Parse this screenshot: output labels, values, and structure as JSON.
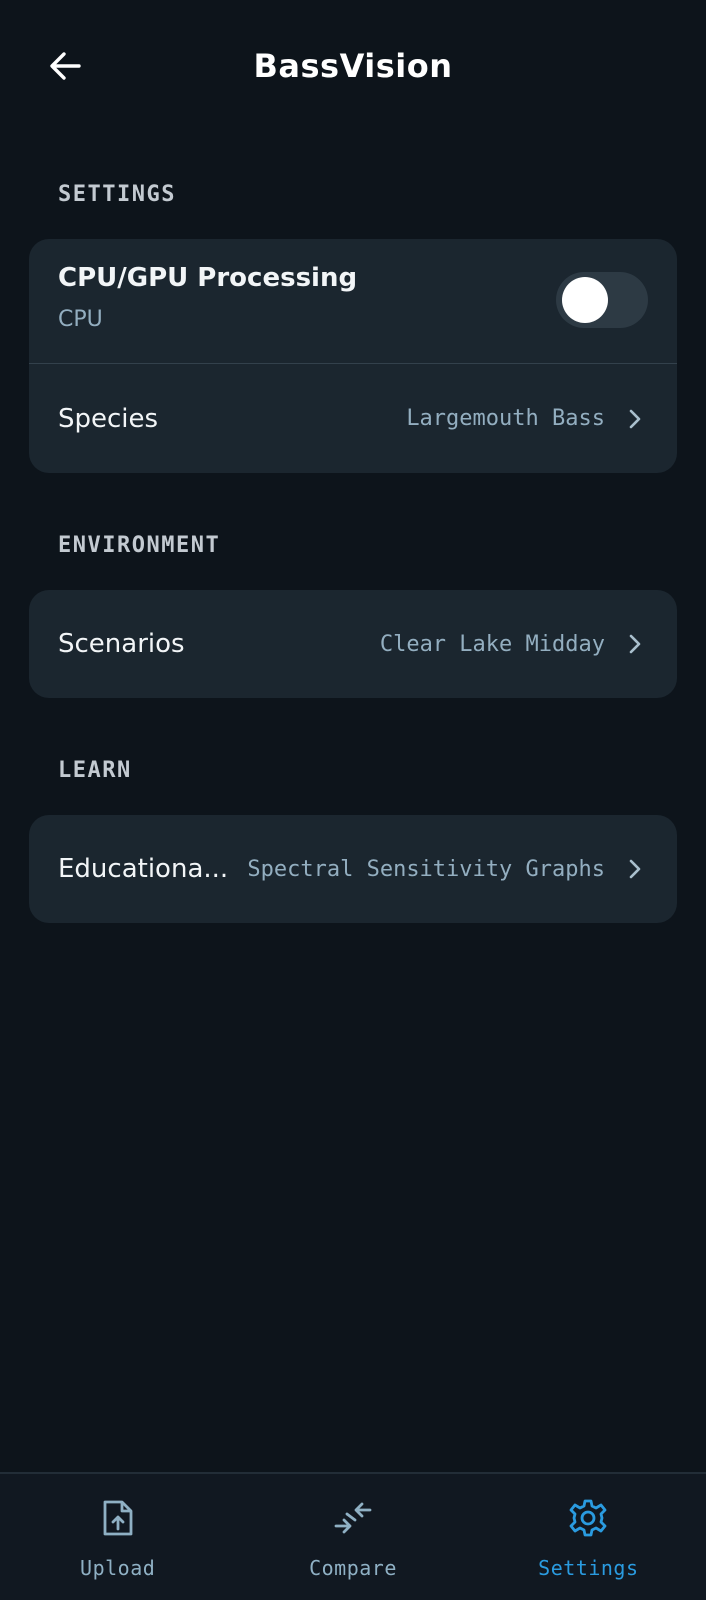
{
  "header": {
    "title": "BassVision",
    "back_icon": "arrow-left-icon"
  },
  "sections": {
    "settings": {
      "label": "SETTINGS",
      "processing": {
        "title": "CPU/GPU Processing",
        "value": "CPU",
        "toggle_on": false
      },
      "species": {
        "title": "Species",
        "value": "Largemouth Bass"
      }
    },
    "environment": {
      "label": "ENVIRONMENT",
      "scenarios": {
        "title": "Scenarios",
        "value": "Clear Lake Midday"
      }
    },
    "learn": {
      "label": "LEARN",
      "educational": {
        "title": "Educationa...",
        "value": "Spectral Sensitivity Graphs"
      }
    }
  },
  "bottom_nav": {
    "items": [
      {
        "label": "Upload",
        "icon": "file-upload-icon",
        "active": false
      },
      {
        "label": "Compare",
        "icon": "compare-arrows-icon",
        "active": false
      },
      {
        "label": "Settings",
        "icon": "gear-icon",
        "active": true
      }
    ]
  },
  "colors": {
    "background": "#0d141b",
    "card": "#1b262f",
    "accent": "#2a9be0",
    "muted": "#93aec0"
  }
}
